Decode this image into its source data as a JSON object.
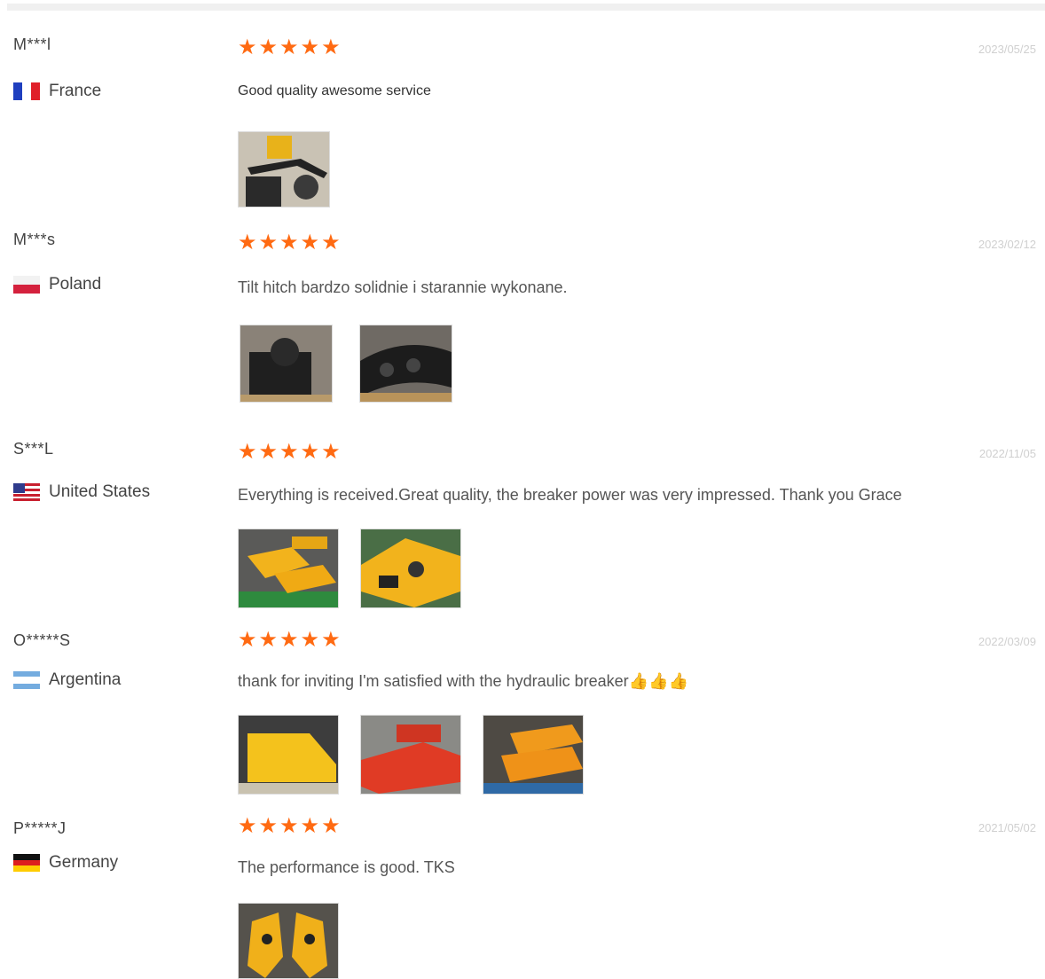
{
  "reviews": [
    {
      "name": "M***l",
      "country": "France",
      "flag_icon": "flag-france-icon",
      "rating": 5,
      "date": "2023/05/25",
      "text": "Good quality awesome service",
      "photos": [
        "yellow-tilt-hitch-photo"
      ]
    },
    {
      "name": "M***s",
      "country": "Poland",
      "flag_icon": "flag-poland-icon",
      "rating": 5,
      "date": "2023/02/12",
      "text": "Tilt hitch bardzo solidnie i starannie wykonane.",
      "photos": [
        "black-tilt-hitch-photo",
        "black-hitches-stacked-photo"
      ]
    },
    {
      "name": "S***L",
      "country": "United States",
      "flag_icon": "flag-usa-icon",
      "rating": 5,
      "date": "2022/11/05",
      "text": "Everything is received.Great quality, the breaker power was very impressed. Thank you Grace",
      "photos": [
        "yellow-breakers-warehouse-photo",
        "yellow-breaker-closeup-photo"
      ]
    },
    {
      "name": "O*****S",
      "country": "Argentina",
      "flag_icon": "flag-argentina-icon",
      "rating": 5,
      "date": "2022/03/09",
      "text": "thank for inviting I'm satisfied with the hydraulic breaker👍👍👍",
      "photos": [
        "yellow-breaker-photo",
        "red-breakers-photo",
        "orange-breakers-photo"
      ]
    },
    {
      "name": "P*****J",
      "country": "Germany",
      "flag_icon": "flag-germany-icon",
      "rating": 5,
      "date": "2021/05/02",
      "text": "The performance is good. TKS",
      "photos": [
        "yellow-grapples-photo"
      ]
    }
  ],
  "colors": {
    "star": "#ff6a12",
    "date": "#d0d0d0",
    "text": "#555555"
  }
}
